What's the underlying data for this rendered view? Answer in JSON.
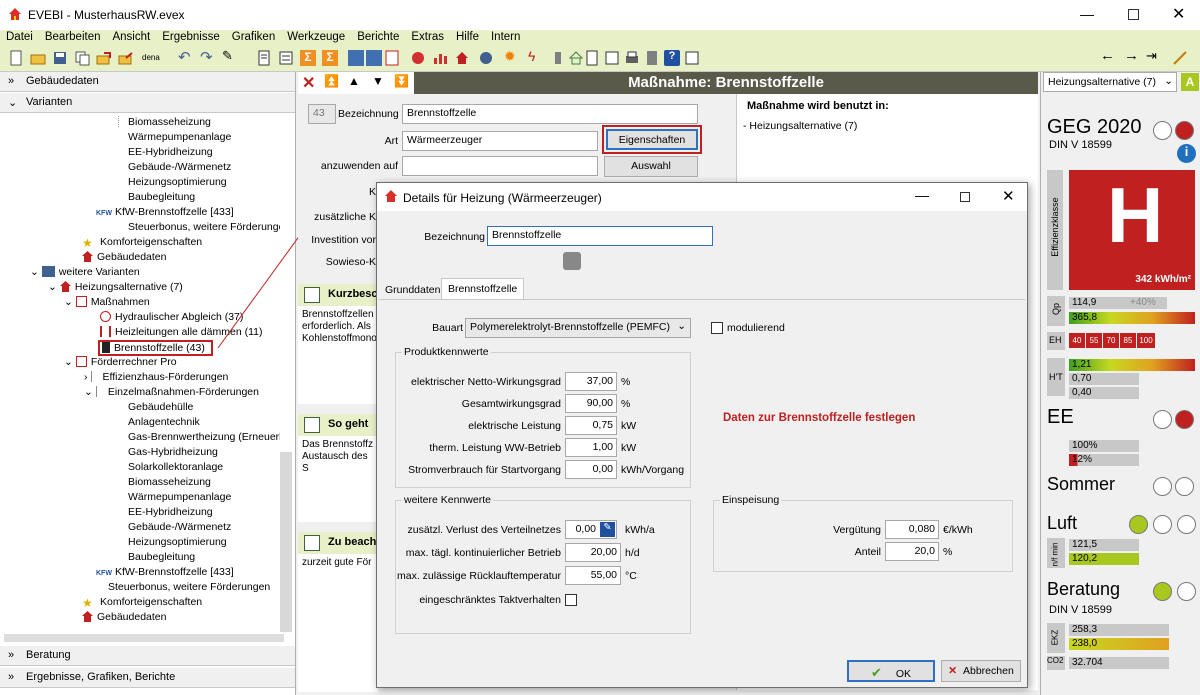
{
  "window": {
    "title": "EVEBI - MusterhausRW.evex"
  },
  "menu": [
    "Datei",
    "Bearbeiten",
    "Ansicht",
    "Ergebnisse",
    "Grafiken",
    "Werkzeuge",
    "Berichte",
    "Extras",
    "Hilfe",
    "Intern"
  ],
  "left": {
    "sections": {
      "gebaeudedaten": "Gebäudedaten",
      "varianten": "Varianten",
      "beratung": "Beratung",
      "ergebnisse": "Ergebnisse, Grafiken, Berichte"
    },
    "tree": [
      "Biomasseheizung",
      "Wärmepumpenanlage",
      "EE-Hybridheizung",
      "Gebäude-/Wärmenetz",
      "Heizungsoptimierung",
      "Baubegleitung",
      "KfW-Brennstoffzelle [433]",
      "Steuerbonus, weitere Förderungen",
      "Komforteigenschaften",
      "Gebäudedaten",
      "weitere Varianten",
      "Heizungsalternative (7)",
      "Maßnahmen",
      "Hydraulischer Abgleich (37)",
      "Heizleitungen alle dämmen (11)",
      "Brennstoffzelle (43)",
      "Förderrechner Pro",
      "Effizienzhaus-Förderungen",
      "Einzelmaßnahmen-Förderungen",
      "Gebäudehülle",
      "Anlagentechnik",
      "Gas-Brennwertheizung (Erneuerbar Ready)",
      "Gas-Hybridheizung",
      "Solarkollektoranlage",
      "Biomasseheizung",
      "Wärmepumpenanlage",
      "EE-Hybridheizung",
      "Gebäude-/Wärmenetz",
      "Heizungsoptimierung",
      "Baubegleitung",
      "KfW-Brennstoffzelle [433]",
      "Steuerbonus, weitere Förderungen",
      "Komforteigenschaften",
      "Gebäudedaten"
    ],
    "kfw_badge": "KFW"
  },
  "center": {
    "header": "Maßnahme: Brennstoffzelle",
    "id": "43",
    "bezeichnung_label": "Bezeichnung",
    "bezeichnung": "Brennstoffzelle",
    "art_label": "Art",
    "art": "Wärmeerzeuger",
    "eigenschaften": "Eigenschaften",
    "anzuwenden_label": "anzuwenden auf",
    "auswahl": "Auswahl",
    "row4_label": "K",
    "row5_label": "zusätzliche K",
    "row6_label": "Investition vor",
    "row7_label": "Sowieso-K",
    "kurz_title": "Kurzbesc",
    "kurz_text": [
      "Brennstoffzellen",
      "erforderlich. Als",
      "Kohlenstoffmono"
    ],
    "so_title": "So geht",
    "so_text": [
      "Das Brennstoffz",
      "Austausch des S"
    ],
    "zu_title": "Zu beach",
    "zu_text": [
      "zurzeit gute För"
    ],
    "used_title": "Maßnahme wird benutzt in:",
    "used_item": "- Heizungsalternative (7)"
  },
  "dialog": {
    "title": "Details für Heizung  (Wärmeerzeuger)",
    "bezeichnung_label": "Bezeichnung",
    "bezeichnung": "Brennstoffzelle",
    "tabs": [
      "Grunddaten",
      "Brennstoffzelle"
    ],
    "bauart_label": "Bauart",
    "bauart": "Polymerelektrolyt-Brennstoffzelle (PEMFC)",
    "modulierend": "modulierend",
    "produkt_legend": "Produktkennwerte",
    "produkt": [
      {
        "label": "elektrischer Netto-Wirkungsgrad",
        "value": "37,00",
        "unit": "%"
      },
      {
        "label": "Gesamtwirkungsgrad",
        "value": "90,00",
        "unit": "%"
      },
      {
        "label": "elektrische Leistung",
        "value": "0,75",
        "unit": "kW"
      },
      {
        "label": "therm. Leistung WW-Betrieb",
        "value": "1,00",
        "unit": "kW"
      },
      {
        "label": "Stromverbrauch für Startvorgang",
        "value": "0,00",
        "unit": "kWh/Vorgang"
      }
    ],
    "hint": "Daten zur Brennstoffzelle festlegen",
    "weitere_legend": "weitere Kennwerte",
    "weitere": [
      {
        "label": "zusätzl. Verlust des Verteilnetzes",
        "value": "0,00",
        "unit": "kWh/a"
      },
      {
        "label": "max. tägl. kontinuierlicher Betrieb",
        "value": "20,00",
        "unit": "h/d"
      },
      {
        "label": "max. zulässige Rücklauftemperatur",
        "value": "55,00",
        "unit": "°C"
      }
    ],
    "takt_label": "eingeschränktes Taktverhalten",
    "einspeisung_legend": "Einspeisung",
    "einspeisung": [
      {
        "label": "Vergütung",
        "value": "0,080",
        "unit": "€/kWh"
      },
      {
        "label": "Anteil",
        "value": "20,0",
        "unit": "%"
      }
    ],
    "ok": "OK",
    "abbrechen": "Abbrechen"
  },
  "side": {
    "dropdown": "Heizungsalternative (7)",
    "geg": "GEG 2020",
    "din": "DIN V 18599",
    "effizienz_label": "Effizienzklasse",
    "klasse": "H",
    "kwh": "342 kWh/m²",
    "qp_label": "Qp",
    "qp1": "114,9",
    "qp_pct": "+40%",
    "qp2": "365,8",
    "eh_label": "EH",
    "eh": [
      "40",
      "55",
      "70",
      "85",
      "100"
    ],
    "ht_label": "H'T",
    "ht": [
      "1,21",
      "0,70",
      "0,40"
    ],
    "ee": "EE",
    "ee1": "100%",
    "ee2": "12%",
    "sommer": "Sommer",
    "luft": "Luft",
    "luft_label": "n/f min",
    "luft1": "121,5",
    "luft2": "120,2",
    "beratung": "Beratung",
    "beratung_din": "DIN V 18599",
    "ekz_label": "EKZ",
    "ekz1": "258,3",
    "ekz2": "238,0",
    "co2_label": "CO2",
    "co2": "32.704"
  },
  "colors": {
    "menubg": "#e8f0c8",
    "red": "#c02020",
    "green": "#a8c820",
    "header": "#5a5a4a"
  }
}
